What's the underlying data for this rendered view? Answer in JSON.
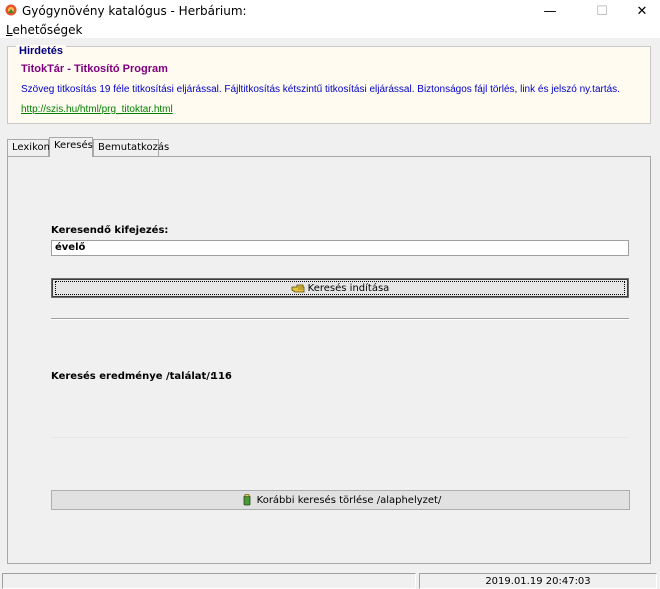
{
  "window": {
    "title": "Gyógynövény katalógus - Herbárium:",
    "controls": {
      "minimize": "—",
      "maximize": "☐",
      "close": "✕"
    }
  },
  "menu": {
    "items": [
      {
        "mnemonic": "L",
        "rest": "ehetőségek"
      }
    ]
  },
  "ad": {
    "legend": "Hirdetés",
    "title": "TitokTár - Titkosító Program",
    "description": "Szöveg titkosítás 19 féle titkosítási eljárással. Fájltitkosítás kétszintű titkosítási eljárással. Biztonságos fájl törlés, link és jelszó ny.tartás.",
    "link": "http://szis.hu/html/prg_titoktar.html"
  },
  "tabs": [
    {
      "label": "Lexikon",
      "active": false
    },
    {
      "label": "Keresés",
      "active": true
    },
    {
      "label": "Bemutatkozás",
      "active": false
    }
  ],
  "search": {
    "label": "Keresendő kifejezés:",
    "value": "évelő",
    "start_button": "Keresés indítása",
    "result_label": "Keresés eredménye /találat/:",
    "result_count": "116",
    "clear_button": "Korábbi keresés törlése /alaphelyzet/"
  },
  "statusbar": {
    "main": "",
    "datetime": "2019.01.19 20:47:03"
  },
  "colors": {
    "ad_background": "#fffbf0",
    "ad_legend": "#00007f",
    "ad_title": "#800080",
    "ad_text": "#0000c8",
    "ad_link": "#008000"
  },
  "icons": {
    "app": "herb-app-icon",
    "start": "pointing-hand-icon",
    "clear": "eraser-icon"
  }
}
